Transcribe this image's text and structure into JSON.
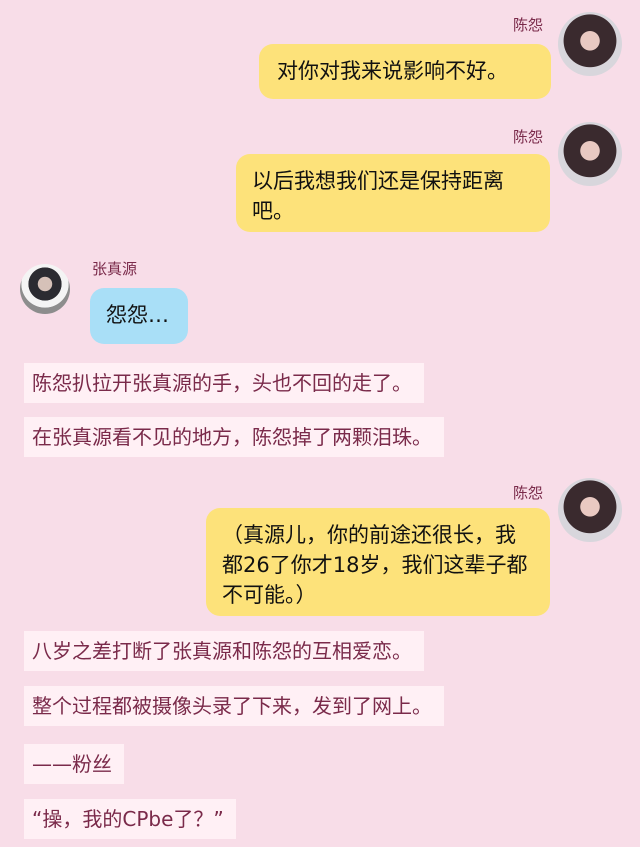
{
  "messages": [
    {
      "sender": "陈怨",
      "text": "对你对我来说影响不好。"
    },
    {
      "sender": "陈怨",
      "text": "以后我想我们还是保持距离吧。"
    },
    {
      "sender": "张真源",
      "text": "怨怨…"
    },
    {
      "sender": "陈怨",
      "text": "（真源儿，你的前途还很长，我都26了你才18岁，我们这辈子都不可能。）"
    }
  ],
  "narration": [
    "陈怨扒拉开张真源的手，头也不回的走了。",
    "在张真源看不见的地方，陈怨掉了两颗泪珠。",
    "八岁之差打断了张真源和陈怨的互相爱恋。",
    "整个过程都被摄像头录了下来，发到了网上。",
    "——粉丝",
    "“操，我的CPbe了？”"
  ]
}
